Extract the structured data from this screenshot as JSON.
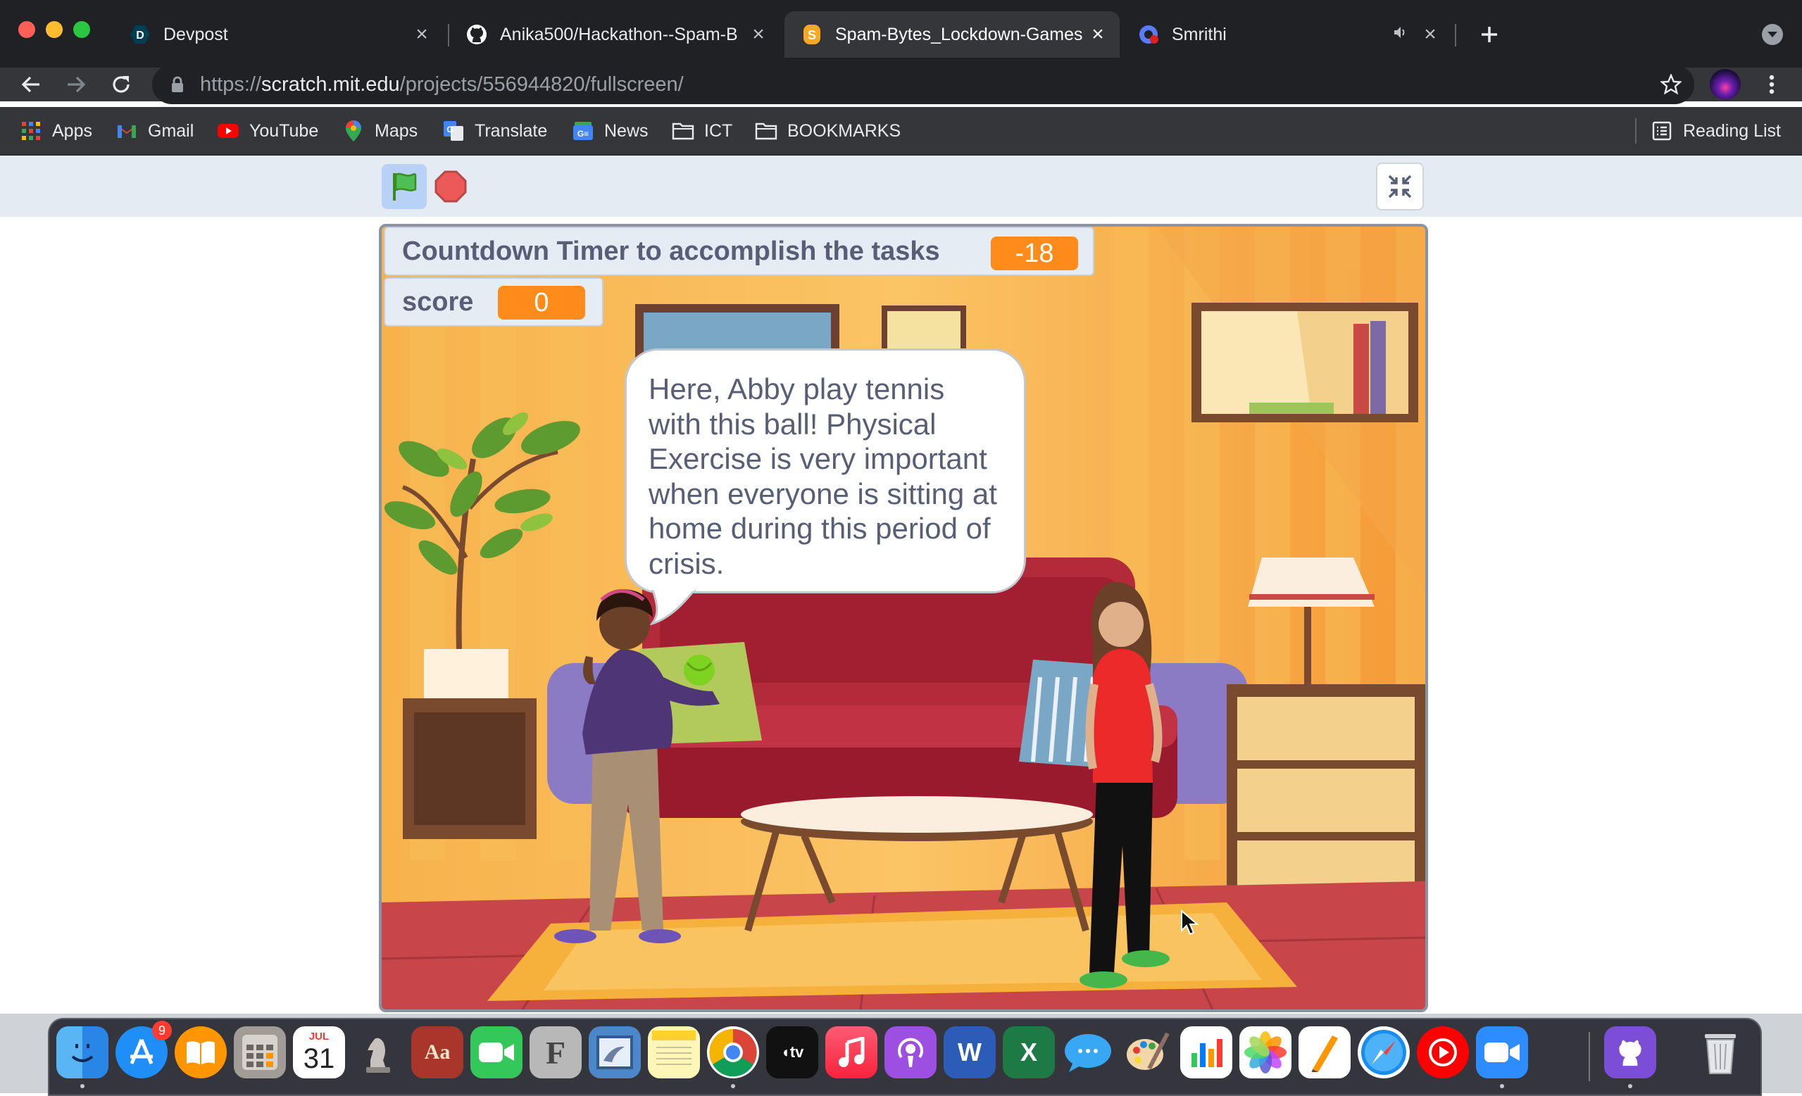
{
  "browser": {
    "tabs": [
      {
        "title": "Devpost",
        "active": false
      },
      {
        "title": "Anika500/Hackathon--Spam-B",
        "active": false
      },
      {
        "title": "Spam-Bytes_Lockdown-Games",
        "active": true
      },
      {
        "title": "Smrithi",
        "active": false,
        "audio": true
      }
    ],
    "url_scheme": "https://",
    "url_domain": "scratch.mit.edu",
    "url_path": "/projects/556944820/fullscreen/",
    "bookmarks": [
      "Apps",
      "Gmail",
      "YouTube",
      "Maps",
      "Translate",
      "News",
      "ICT",
      "BOOKMARKS"
    ],
    "reading_list": "Reading List"
  },
  "scratch": {
    "timer_label": "Countdown Timer to accomplish the tasks",
    "timer_value": "-18",
    "score_label": "score",
    "score_value": "0",
    "speech_bubble": "Here, Abby play tennis\nwith this ball! Physical\nExercise is very important\nwhen everyone is sitting at\nhome during this period of\ncrisis.",
    "accent_color": "#ff8c1a"
  },
  "dock": {
    "apps": [
      "finder-icon",
      "app-store-icon",
      "books-icon",
      "calculator-icon",
      "calendar-icon",
      "chess-icon",
      "dictionary-icon",
      "facetime-icon",
      "font-book-icon",
      "preview-icon",
      "notes-icon",
      "chrome-icon",
      "apple-tv-icon",
      "music-icon",
      "podcasts-icon",
      "word-icon",
      "excel-icon",
      "messages-icon",
      "paintbrush-icon",
      "numbers-icon",
      "photos-icon",
      "pages-icon",
      "safari-icon",
      "youtube-music-icon",
      "zoom-icon",
      "github-desktop-icon",
      "trash-icon"
    ],
    "app_store_badge": "9",
    "calendar_month": "JUL",
    "calendar_day": "31",
    "dictionary_label": "Aa",
    "font_book_label": "F",
    "word_label": "W",
    "excel_label": "X"
  }
}
